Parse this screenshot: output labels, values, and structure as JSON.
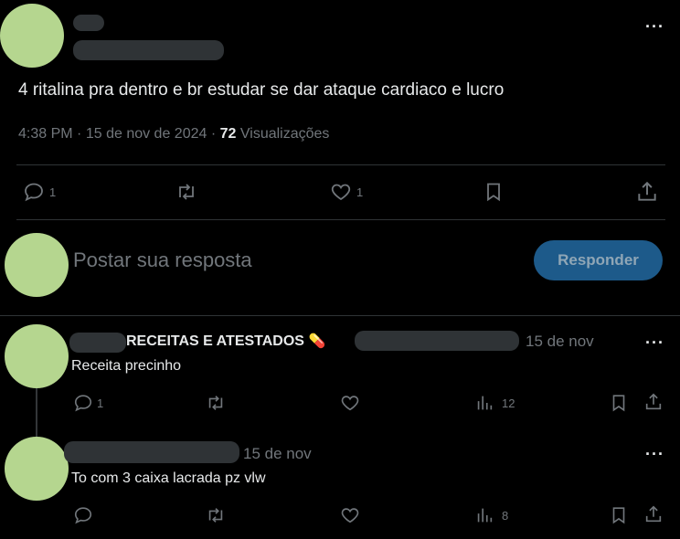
{
  "main_tweet": {
    "text": "4 ritalina pra dentro e br estudar se dar ataque cardiaco e lucro",
    "time": "4:38 PM",
    "date": "15 de nov de 2024",
    "views_count": "72",
    "views_label": "Visualizações",
    "replies": "1",
    "likes": "1"
  },
  "composer": {
    "placeholder": "Postar sua resposta",
    "button_label": "Responder"
  },
  "replies": [
    {
      "name_suffix": "RECEITAS E ATESTADOS",
      "name_emoji": "💊",
      "date": "15 de nov",
      "text": "Receita precinho",
      "replies": "1",
      "views": "12"
    },
    {
      "date": "15 de nov",
      "text": "To com 3 caixa lacrada pz vlw",
      "views": "8"
    }
  ],
  "icons": {
    "more": "more-icon",
    "reply": "reply-icon",
    "retweet": "retweet-icon",
    "like": "heart-icon",
    "bookmark": "bookmark-icon",
    "share": "share-icon",
    "views": "views-icon"
  },
  "colors": {
    "background": "#000000",
    "text": "#e7e9ea",
    "muted": "#71767b",
    "accent_button": "#1d5a8a",
    "avatar": "#b5d68f"
  }
}
